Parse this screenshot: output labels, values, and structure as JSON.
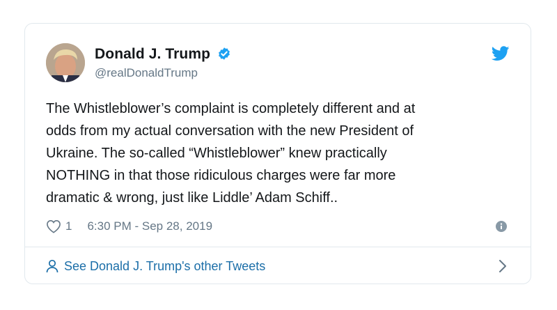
{
  "author": {
    "display_name": "Donald J. Trump",
    "handle": "@realDonaldTrump",
    "verified": true
  },
  "tweet": {
    "lines": [
      "The Whistleblower’s complaint is completely different and at",
      "odds from my actual conversation with the new President of",
      "Ukraine. The so-called “Whistleblower” knew practically",
      "NOTHING in that those ridiculous charges were far more",
      "dramatic & wrong, just like Liddle’ Adam Schiff.."
    ],
    "like_count": "1",
    "timestamp": "6:30 PM - Sep 28, 2019"
  },
  "footer": {
    "link_label": "See Donald J. Trump's other Tweets"
  },
  "icons": {
    "brand": "twitter-bird-icon",
    "verified": "verified-badge-icon",
    "like": "heart-icon",
    "info": "info-icon",
    "person": "person-icon",
    "chevron": "chevron-right-icon"
  },
  "colors": {
    "accent": "#1da1f2",
    "link": "#1b6ea8",
    "text": "#14171a",
    "muted": "#657786",
    "border": "#e1e8ed"
  }
}
